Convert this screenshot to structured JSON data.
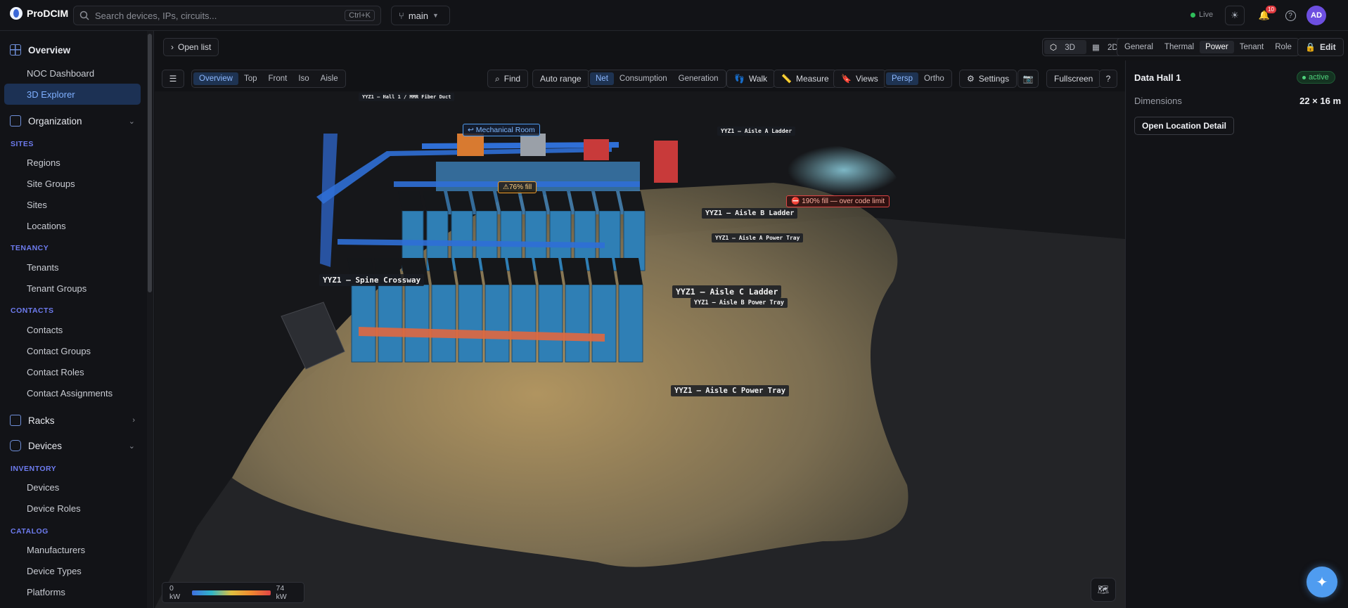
{
  "app": {
    "brand": "ProDCIM"
  },
  "topbar": {
    "search_placeholder": "Search devices, IPs, circuits...",
    "search_shortcut": "Ctrl+K",
    "branch": "main",
    "live_label": "Live",
    "notifications_count": "10",
    "avatar_initials": "AD"
  },
  "sidebar": {
    "overview": "Overview",
    "noc": "NOC Dashboard",
    "explorer": "3D Explorer",
    "organization": "Organization",
    "sec_sites": "SITES",
    "regions": "Regions",
    "site_groups": "Site Groups",
    "sites": "Sites",
    "locations": "Locations",
    "sec_tenancy": "TENANCY",
    "tenants": "Tenants",
    "tenant_groups": "Tenant Groups",
    "sec_contacts": "CONTACTS",
    "contacts": "Contacts",
    "contact_groups": "Contact Groups",
    "contact_roles": "Contact Roles",
    "contact_assignments": "Contact Assignments",
    "racks": "Racks",
    "devices": "Devices",
    "sec_inventory": "INVENTORY",
    "inv_devices": "Devices",
    "device_roles": "Device Roles",
    "sec_catalog": "CATALOG",
    "manufacturers": "Manufacturers",
    "device_types": "Device Types",
    "platforms": "Platforms"
  },
  "subbar": {
    "open_list": "Open list",
    "view3d": "3D",
    "view2d": "2D",
    "overlay_tabs": [
      "General",
      "Thermal",
      "Power",
      "Tenant",
      "Role"
    ],
    "overlay_active": "Power",
    "edit": "Edit"
  },
  "toolbar": {
    "camera_tabs": [
      "Overview",
      "Top",
      "Front",
      "Iso",
      "Aisle"
    ],
    "find": "Find",
    "auto_range": "Auto range",
    "power_tabs": [
      "Net",
      "Consumption",
      "Generation"
    ],
    "walk": "Walk",
    "measure": "Measure",
    "views": "Views",
    "proj_tabs": [
      "Persp",
      "Ortho"
    ],
    "settings": "Settings",
    "fullscreen": "Fullscreen",
    "help": "?"
  },
  "scene": {
    "labels": {
      "fiber_duct": "YYZ1 — Hall 1 / MMR Fiber Duct",
      "mech_room": "Mechanical Room",
      "fill76": "76% fill",
      "aisle_a_ladder": "YYZ1 — Aisle A Ladder",
      "over_limit": "190% fill — over code limit",
      "aisle_b_ladder": "YYZ1 — Aisle B Ladder",
      "aisle_a_power": "YYZ1 — Aisle A Power Tray",
      "spine": "YYZ1 — Spine Crossway",
      "aisle_c_ladder": "YYZ1 — Aisle C Ladder",
      "aisle_b_power": "YYZ1 — Aisle B Power Tray",
      "aisle_c_power": "YYZ1 — Aisle C Power Tray"
    }
  },
  "legend": {
    "min": "0 kW",
    "max": "74 kW"
  },
  "panel": {
    "title": "Data Hall 1",
    "status": "active",
    "dimensions_label": "Dimensions",
    "dimensions_value": "22 × 16 m",
    "open_detail": "Open Location Detail"
  },
  "colors": {
    "accent": "#4f9cf0",
    "active_nav": "#1c3154",
    "status_green": "#4fd27c",
    "warning": "#f0a030",
    "danger": "#e04545"
  }
}
